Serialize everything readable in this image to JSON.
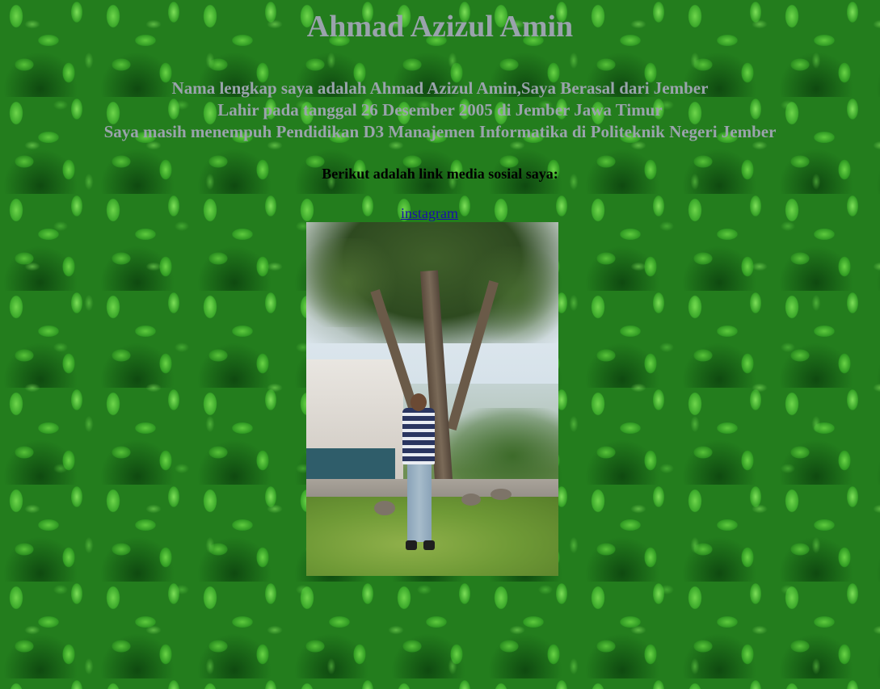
{
  "page": {
    "title": "Ahmad Azizul Amin",
    "bio_lines": [
      "Nama lengkap saya adalah Ahmad Azizul Amin,Saya Berasal dari Jember",
      "Lahir pada tanggal 26 Desember 2005 di Jember Jawa Timur",
      "Saya masih menempuh Pendidikan D3 Manajemen Informatika di Politeknik Negeri Jember"
    ],
    "social_heading": "Berikut adalah link media sosial saya:",
    "instagram_link": "instagram"
  },
  "colors": {
    "heading_text": "#9aa3ac",
    "link": "#1a0dab",
    "background_green": "#237d1d"
  },
  "icons": {
    "background": "leaf-pattern",
    "photo": "profile-photo"
  }
}
